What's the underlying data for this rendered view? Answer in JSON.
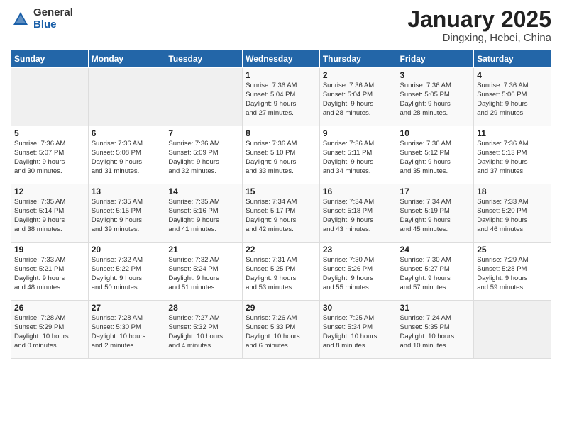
{
  "logo": {
    "general": "General",
    "blue": "Blue"
  },
  "title": {
    "month": "January 2025",
    "location": "Dingxing, Hebei, China"
  },
  "headers": [
    "Sunday",
    "Monday",
    "Tuesday",
    "Wednesday",
    "Thursday",
    "Friday",
    "Saturday"
  ],
  "weeks": [
    [
      {
        "day": "",
        "info": ""
      },
      {
        "day": "",
        "info": ""
      },
      {
        "day": "",
        "info": ""
      },
      {
        "day": "1",
        "info": "Sunrise: 7:36 AM\nSunset: 5:04 PM\nDaylight: 9 hours\nand 27 minutes."
      },
      {
        "day": "2",
        "info": "Sunrise: 7:36 AM\nSunset: 5:04 PM\nDaylight: 9 hours\nand 28 minutes."
      },
      {
        "day": "3",
        "info": "Sunrise: 7:36 AM\nSunset: 5:05 PM\nDaylight: 9 hours\nand 28 minutes."
      },
      {
        "day": "4",
        "info": "Sunrise: 7:36 AM\nSunset: 5:06 PM\nDaylight: 9 hours\nand 29 minutes."
      }
    ],
    [
      {
        "day": "5",
        "info": "Sunrise: 7:36 AM\nSunset: 5:07 PM\nDaylight: 9 hours\nand 30 minutes."
      },
      {
        "day": "6",
        "info": "Sunrise: 7:36 AM\nSunset: 5:08 PM\nDaylight: 9 hours\nand 31 minutes."
      },
      {
        "day": "7",
        "info": "Sunrise: 7:36 AM\nSunset: 5:09 PM\nDaylight: 9 hours\nand 32 minutes."
      },
      {
        "day": "8",
        "info": "Sunrise: 7:36 AM\nSunset: 5:10 PM\nDaylight: 9 hours\nand 33 minutes."
      },
      {
        "day": "9",
        "info": "Sunrise: 7:36 AM\nSunset: 5:11 PM\nDaylight: 9 hours\nand 34 minutes."
      },
      {
        "day": "10",
        "info": "Sunrise: 7:36 AM\nSunset: 5:12 PM\nDaylight: 9 hours\nand 35 minutes."
      },
      {
        "day": "11",
        "info": "Sunrise: 7:36 AM\nSunset: 5:13 PM\nDaylight: 9 hours\nand 37 minutes."
      }
    ],
    [
      {
        "day": "12",
        "info": "Sunrise: 7:35 AM\nSunset: 5:14 PM\nDaylight: 9 hours\nand 38 minutes."
      },
      {
        "day": "13",
        "info": "Sunrise: 7:35 AM\nSunset: 5:15 PM\nDaylight: 9 hours\nand 39 minutes."
      },
      {
        "day": "14",
        "info": "Sunrise: 7:35 AM\nSunset: 5:16 PM\nDaylight: 9 hours\nand 41 minutes."
      },
      {
        "day": "15",
        "info": "Sunrise: 7:34 AM\nSunset: 5:17 PM\nDaylight: 9 hours\nand 42 minutes."
      },
      {
        "day": "16",
        "info": "Sunrise: 7:34 AM\nSunset: 5:18 PM\nDaylight: 9 hours\nand 43 minutes."
      },
      {
        "day": "17",
        "info": "Sunrise: 7:34 AM\nSunset: 5:19 PM\nDaylight: 9 hours\nand 45 minutes."
      },
      {
        "day": "18",
        "info": "Sunrise: 7:33 AM\nSunset: 5:20 PM\nDaylight: 9 hours\nand 46 minutes."
      }
    ],
    [
      {
        "day": "19",
        "info": "Sunrise: 7:33 AM\nSunset: 5:21 PM\nDaylight: 9 hours\nand 48 minutes."
      },
      {
        "day": "20",
        "info": "Sunrise: 7:32 AM\nSunset: 5:22 PM\nDaylight: 9 hours\nand 50 minutes."
      },
      {
        "day": "21",
        "info": "Sunrise: 7:32 AM\nSunset: 5:24 PM\nDaylight: 9 hours\nand 51 minutes."
      },
      {
        "day": "22",
        "info": "Sunrise: 7:31 AM\nSunset: 5:25 PM\nDaylight: 9 hours\nand 53 minutes."
      },
      {
        "day": "23",
        "info": "Sunrise: 7:30 AM\nSunset: 5:26 PM\nDaylight: 9 hours\nand 55 minutes."
      },
      {
        "day": "24",
        "info": "Sunrise: 7:30 AM\nSunset: 5:27 PM\nDaylight: 9 hours\nand 57 minutes."
      },
      {
        "day": "25",
        "info": "Sunrise: 7:29 AM\nSunset: 5:28 PM\nDaylight: 9 hours\nand 59 minutes."
      }
    ],
    [
      {
        "day": "26",
        "info": "Sunrise: 7:28 AM\nSunset: 5:29 PM\nDaylight: 10 hours\nand 0 minutes."
      },
      {
        "day": "27",
        "info": "Sunrise: 7:28 AM\nSunset: 5:30 PM\nDaylight: 10 hours\nand 2 minutes."
      },
      {
        "day": "28",
        "info": "Sunrise: 7:27 AM\nSunset: 5:32 PM\nDaylight: 10 hours\nand 4 minutes."
      },
      {
        "day": "29",
        "info": "Sunrise: 7:26 AM\nSunset: 5:33 PM\nDaylight: 10 hours\nand 6 minutes."
      },
      {
        "day": "30",
        "info": "Sunrise: 7:25 AM\nSunset: 5:34 PM\nDaylight: 10 hours\nand 8 minutes."
      },
      {
        "day": "31",
        "info": "Sunrise: 7:24 AM\nSunset: 5:35 PM\nDaylight: 10 hours\nand 10 minutes."
      },
      {
        "day": "",
        "info": ""
      }
    ]
  ]
}
